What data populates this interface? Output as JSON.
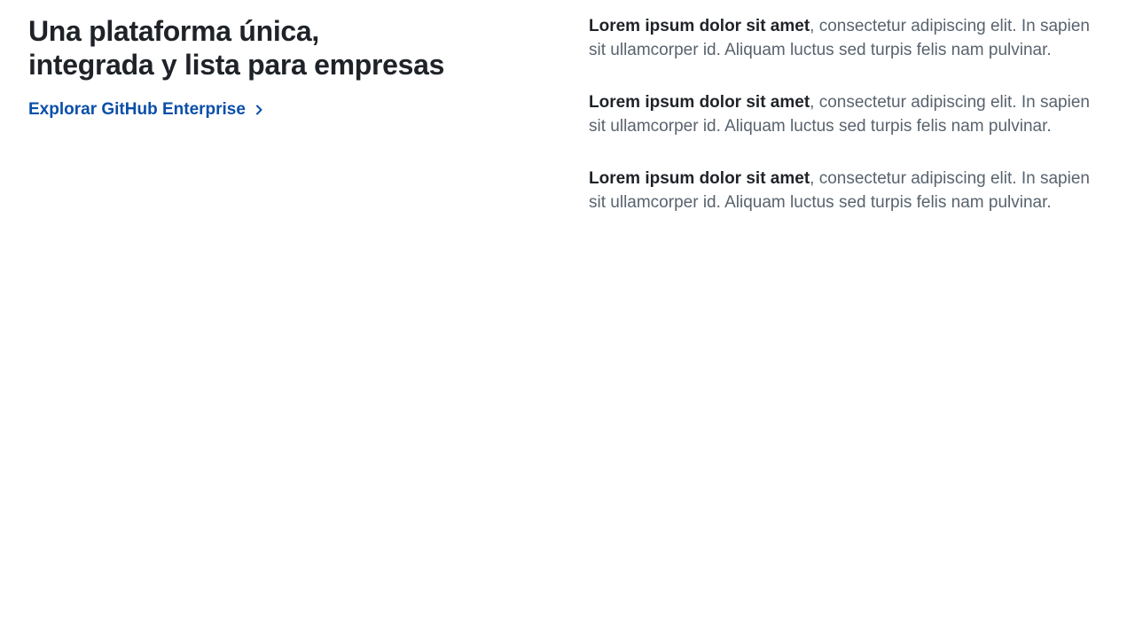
{
  "section": {
    "heading": "Una plataforma única,\nintegrada y lista para empresas",
    "cta": {
      "label": "Explorar GitHub Enterprise",
      "icon": "chevron-right-icon"
    }
  },
  "features": [
    {
      "title": "Lorem ipsum dolor sit amet",
      "body": ", consectetur adipiscing elit. In sapien sit ullamcorper id. Aliquam luctus sed turpis felis nam pulvinar."
    },
    {
      "title": "Lorem ipsum dolor sit amet",
      "body": ", consectetur adipiscing elit. In sapien sit ullamcorper id. Aliquam luctus sed turpis felis nam pulvinar."
    },
    {
      "title": "Lorem ipsum dolor sit amet",
      "body": ", consectetur adipiscing elit. In sapien sit ullamcorper id. Aliquam luctus sed turpis felis nam pulvinar."
    }
  ],
  "colors": {
    "heading": "#1f2328",
    "link": "#0a4fa8",
    "body_text": "#59636e",
    "background": "#ffffff"
  }
}
